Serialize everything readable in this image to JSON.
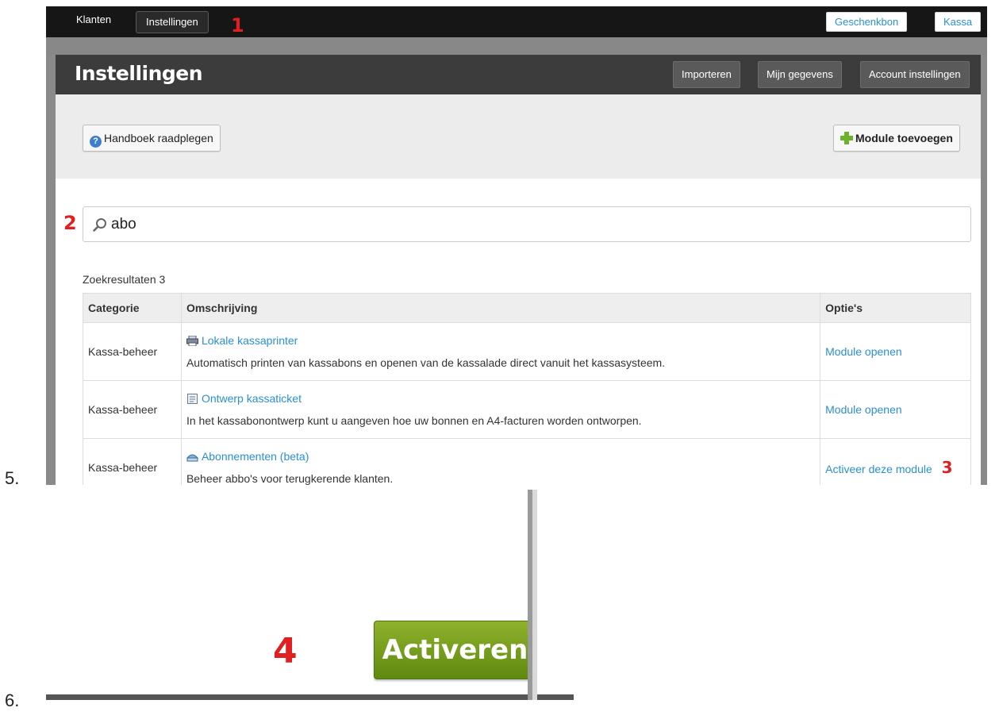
{
  "labels": {
    "step1": "5.",
    "step2": "6."
  },
  "steps": {
    "one": "1",
    "two": "2",
    "three": "3",
    "four": "4"
  },
  "topbar": {
    "nav": [
      "Klanten",
      "Instellingen"
    ],
    "buttons": [
      "Geschenkbon",
      "Kassa"
    ]
  },
  "header": {
    "title": "Instellingen",
    "buttons": [
      "Importeren",
      "Mijn gegevens",
      "Account instellingen"
    ]
  },
  "toolbar": {
    "help_label": "Handboek raadplegen",
    "add_module_label": "Module toevoegen"
  },
  "search": {
    "value": "abo"
  },
  "results": {
    "count_label": "Zoekresultaten 3",
    "columns": [
      "Categorie",
      "Omschrijving",
      "Optie's"
    ],
    "rows": [
      {
        "category": "Kassa-beheer",
        "title": "Lokale kassaprinter",
        "description": "Automatisch printen van kassabons en openen van de kassalade direct vanuit het kassasysteem.",
        "option": "Module openen",
        "icon": "printer-icon"
      },
      {
        "category": "Kassa-beheer",
        "title": "Ontwerp kassaticket",
        "description": "In het kassabonontwerp kunt u aangeven hoe uw bonnen en A4-facturen worden ontworpen.",
        "option": "Module openen",
        "icon": "ticket-icon"
      },
      {
        "category": "Kassa-beheer",
        "title": "Abonnementen (beta)",
        "description": "Beheer abbo's voor terugkerende klanten.",
        "option": "Activeer deze module",
        "icon": "subscription-icon"
      }
    ]
  },
  "activate": {
    "button_label": "Activeren"
  },
  "colors": {
    "link": "#2a8fd6",
    "step_marker": "#e02020",
    "activate_button": "#6f9a1a",
    "titlebar": "#3c3c3c"
  }
}
